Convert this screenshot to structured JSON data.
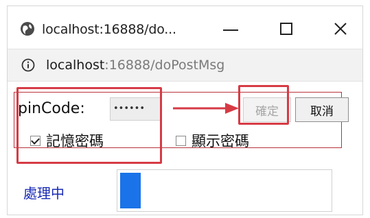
{
  "window": {
    "title": "localhost:16888/do...",
    "minimize_label": "",
    "maximize_label": "",
    "close_label": "×"
  },
  "address": {
    "host": "localhost",
    "rest": ":16888/doPostMsg"
  },
  "form": {
    "pin_label": "pinCode:",
    "pin_masked": "••••••",
    "confirm_label": "確定",
    "cancel_label": "取消",
    "remember_label": "記憶密碼",
    "remember_checked": true,
    "show_label": "顯示密碼",
    "show_checked": false
  },
  "progress": {
    "label": "處理中",
    "value": 0.1
  },
  "colors": {
    "annotation": "#d63b45",
    "progress": "#1a73e8",
    "processing_text": "#1a2bb5"
  },
  "icons": {
    "globe": "globe-icon",
    "info": "info-icon",
    "arrow": "right-arrow-annotation"
  }
}
